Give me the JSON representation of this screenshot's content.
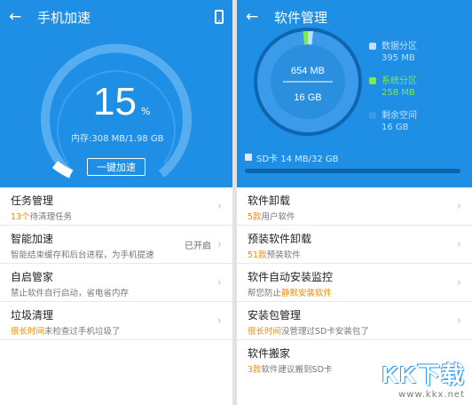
{
  "left": {
    "title": "手机加速",
    "percent": "15",
    "percent_sign": "%",
    "memory": "内存:308 MB/1.98 GB",
    "boost_button": "一键加速",
    "items": [
      {
        "title": "任务管理",
        "sub_highlight": "13个",
        "sub_text": "待清理任务",
        "status": ""
      },
      {
        "title": "智能加速",
        "sub_highlight": "",
        "sub_text": "智能结束缓存和后台进程，为手机提速",
        "status": "已开启"
      },
      {
        "title": "自启管家",
        "sub_highlight": "",
        "sub_text": "禁止软件自行启动，省电省内存",
        "status": ""
      },
      {
        "title": "垃圾清理",
        "sub_highlight": "很长时间",
        "sub_text": "未检查过手机垃圾了",
        "status": ""
      }
    ]
  },
  "right": {
    "title": "软件管理",
    "donut_top": "654 MB",
    "donut_bottom": "16 GB",
    "legend": [
      {
        "name": "数据分区",
        "value": "395 MB",
        "color": "#bfe0fb"
      },
      {
        "name": "系统分区",
        "value": "258 MB",
        "color": "#7bea4a"
      },
      {
        "name": "剩余空间",
        "value": "16 GB",
        "color": "#3b9aea"
      }
    ],
    "sd_card": "SD卡 14 MB/32 GB",
    "items": [
      {
        "title": "软件卸载",
        "sub_pre": "",
        "sub_highlight": "5款",
        "sub_text": "用户软件"
      },
      {
        "title": "预装软件卸载",
        "sub_pre": "",
        "sub_highlight": "51款",
        "sub_text": "预装软件"
      },
      {
        "title": "软件自动安装监控",
        "sub_pre": "帮您防止",
        "sub_highlight": "静默安装软件",
        "sub_text": ""
      },
      {
        "title": "安装包管理",
        "sub_pre": "",
        "sub_highlight": "很长时间",
        "sub_text": "没管理过SD卡安装包了"
      },
      {
        "title": "软件搬家",
        "sub_pre": "",
        "sub_highlight": "3款",
        "sub_text": "软件建议搬到SD卡"
      }
    ]
  },
  "watermark": {
    "logo": "KK下载",
    "url": "www.kkx.net"
  }
}
